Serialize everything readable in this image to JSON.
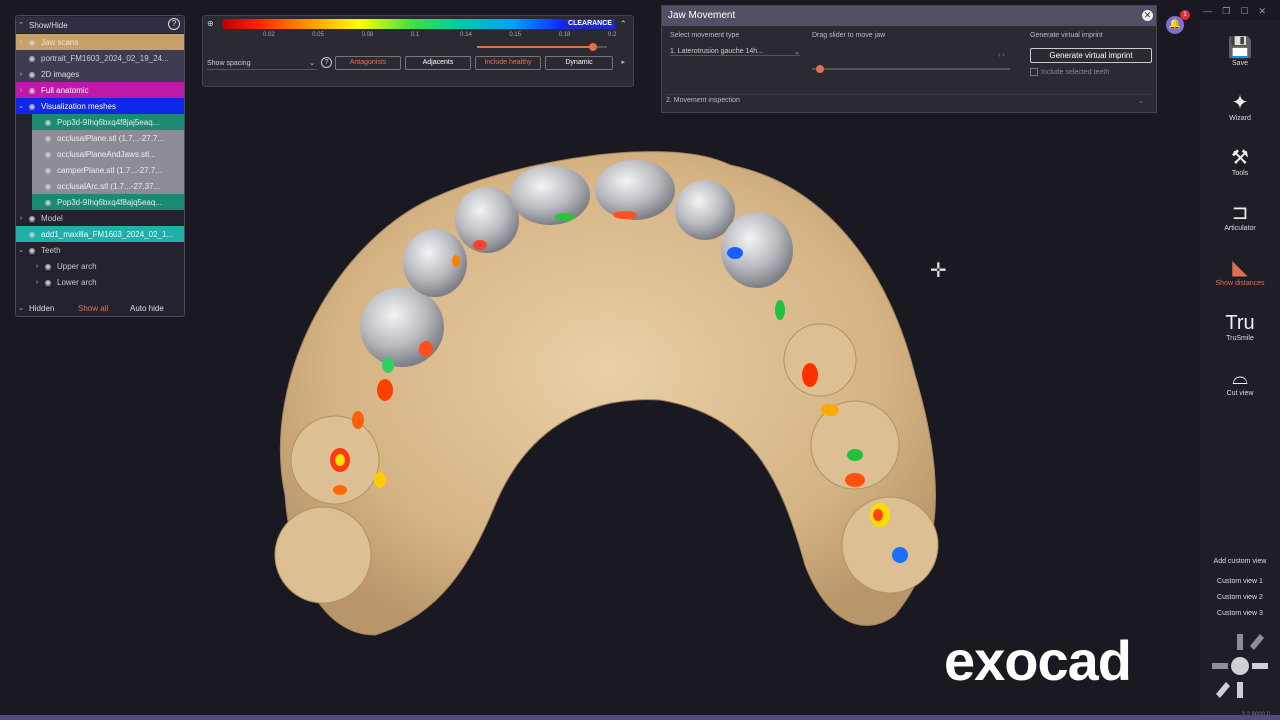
{
  "colors": {
    "accent": "#e07050",
    "tree_header": "#2f2e44"
  },
  "tree": {
    "header": "Show/Hide",
    "rows": [
      {
        "label": "Jaw scans",
        "indent": 0,
        "bg": "#c9a06a",
        "fg": "#f3e2c8",
        "caret": "›"
      },
      {
        "label": "portrait_FM1603_2024_02_19_24...",
        "indent": 0,
        "bg": "#3d3c52",
        "fg": "#ccc",
        "caret": ""
      },
      {
        "label": "2D images",
        "indent": 0,
        "bg": "#3d3c52",
        "fg": "#ddd",
        "caret": "›"
      },
      {
        "label": "Full anatomic",
        "indent": 0,
        "bg": "#c018a8",
        "fg": "#fff",
        "caret": "›"
      },
      {
        "label": "Visualization meshes",
        "indent": 0,
        "bg": "#1026e8",
        "fg": "#fff",
        "caret": "⌄"
      },
      {
        "label": "Pop3d-9Ihq6bxq4f8jaj5eaq...",
        "indent": 1,
        "bg": "#1a8a74",
        "fg": "#e0f0ea",
        "caret": ""
      },
      {
        "label": "occlusalPlane.stl (1.7...-27.7...",
        "indent": 1,
        "bg": "#8d8c94",
        "fg": "#eee",
        "caret": ""
      },
      {
        "label": "occlusalPlaneAndJaws.stl...",
        "indent": 1,
        "bg": "#8d8c94",
        "fg": "#eee",
        "caret": ""
      },
      {
        "label": "camperPlane.stl (1.7...-27.7...",
        "indent": 1,
        "bg": "#8d8c94",
        "fg": "#eee",
        "caret": ""
      },
      {
        "label": "occlusalArc.stl (1.7...-27.37...",
        "indent": 1,
        "bg": "#8d8c94",
        "fg": "#eee",
        "caret": ""
      },
      {
        "label": "Pop3d-9Ihq6bxq4f8ajq5eaq...",
        "indent": 1,
        "bg": "#1a8a74",
        "fg": "#e0f0ea",
        "caret": ""
      },
      {
        "label": "Model",
        "indent": 0,
        "bg": "#23222e",
        "fg": "#ccc",
        "caret": "›"
      },
      {
        "label": "add1_maxilla_FM1603_2024_02_1...",
        "indent": 0,
        "bg": "#1fb0a8",
        "fg": "#e6fffc",
        "caret": ""
      },
      {
        "label": "Teeth",
        "indent": 0,
        "bg": "#23222e",
        "fg": "#ccc",
        "caret": "⌄"
      },
      {
        "label": "Upper arch",
        "indent": 1,
        "bg": "#23222e",
        "fg": "#ccc",
        "caret": "›"
      },
      {
        "label": "Lower arch",
        "indent": 1,
        "bg": "#23222e",
        "fg": "#ccc",
        "caret": "›"
      }
    ],
    "footer": {
      "hidden": "Hidden",
      "show_all": "Show all",
      "auto_hide": "Auto hide"
    }
  },
  "scale": {
    "clearance": "CLEARANCE",
    "ticks": [
      "0.02",
      "0.05",
      "0.08",
      "0.1",
      "0.14",
      "0.15",
      "0.18",
      "0.2"
    ],
    "threshold": 0.18,
    "dropdown": "Show spacing",
    "buttons": [
      "Antagonists",
      "Adjacents",
      "Include healthy",
      "Dynamic"
    ]
  },
  "jaw": {
    "title": "Jaw Movement",
    "movement_type_label": "Select movement type",
    "movement_type_value": "1. Laterotrusion gauche 14h...",
    "drag_label": "Drag slider to move jaw",
    "generate_label": "Generate virtual imprint",
    "generate_button": "Generate virtual imprint",
    "include_label": "Include selected teeth",
    "section": "2. Movement inspection",
    "slider_pos": 0.02
  },
  "toolbar": [
    {
      "label": "Save",
      "icon": "💾",
      "name": "save"
    },
    {
      "label": "Wizard",
      "icon": "✦",
      "name": "wizard"
    },
    {
      "label": "Tools",
      "icon": "⚒",
      "name": "tools"
    },
    {
      "label": "Articulator",
      "icon": "⊐",
      "name": "articulator"
    },
    {
      "label": "Show distances",
      "icon": "◣",
      "name": "show-distances"
    },
    {
      "label": "TruSmile",
      "icon": "Tru",
      "name": "trusmile"
    },
    {
      "label": "Cut view",
      "icon": "⌓",
      "name": "cut-view"
    }
  ],
  "views": {
    "add": "Add custom view",
    "items": [
      "Custom view 1",
      "Custom view 2",
      "Custom view 3"
    ]
  },
  "logo": "exocad",
  "notifications": "1",
  "version": "3.2.8000.0"
}
